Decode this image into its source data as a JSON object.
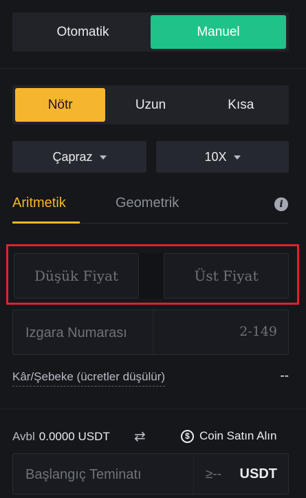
{
  "mode_toggle": {
    "options": [
      "Otomatik",
      "Manuel"
    ],
    "selected": "Manuel"
  },
  "direction_toggle": {
    "options": [
      "Nötr",
      "Uzun",
      "Kısa"
    ],
    "selected": "Nötr"
  },
  "margin_mode": {
    "value": "Çapraz",
    "icon": "caret-down-icon"
  },
  "leverage": {
    "value": "10X",
    "icon": "caret-down-icon"
  },
  "grid_tabs": {
    "items": [
      "Aritmetik",
      "Geometrik"
    ],
    "active": "Aritmetik",
    "info_icon": "i"
  },
  "price_range": {
    "lower_placeholder": "Düşük Fiyat",
    "upper_placeholder": "Üst Fiyat"
  },
  "grid_number": {
    "placeholder": "Izgara Numarası",
    "range": "2-149"
  },
  "profit_per_grid": {
    "label": "Kâr/Şebeke (ücretler düşülür)",
    "value": "--"
  },
  "balance": {
    "label": "Avbl",
    "value": "0.0000 USDT",
    "swap_icon": "⇄",
    "buy_label": "Coin Satın Alın",
    "buy_icon": "$"
  },
  "initial_margin": {
    "placeholder": "Başlangıç Teminatı",
    "min": "≥--",
    "unit": "USDT"
  },
  "colors": {
    "background": "#16171b",
    "manual_active": "#1fc38a",
    "neutral_active": "#f6b52e",
    "highlight": "#e2212a"
  }
}
